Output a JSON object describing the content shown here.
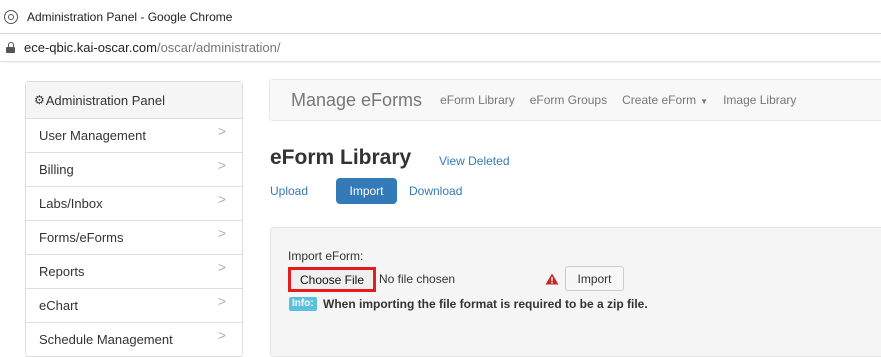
{
  "browser": {
    "window_title": "Administration Panel - Google Chrome",
    "url_host": "ece-qbic.kai-oscar.com",
    "url_path": "/oscar/administration/"
  },
  "sidebar": {
    "header": "Administration Panel",
    "items": [
      {
        "label": "User Management"
      },
      {
        "label": "Billing"
      },
      {
        "label": "Labs/Inbox"
      },
      {
        "label": "Forms/eForms"
      },
      {
        "label": "Reports"
      },
      {
        "label": "eChart"
      },
      {
        "label": "Schedule Management"
      }
    ]
  },
  "topnav": {
    "brand": "Manage eForms",
    "links": [
      "eForm Library",
      "eForm Groups",
      "Create eForm",
      "Image Library"
    ]
  },
  "page": {
    "title": "eForm Library",
    "view_deleted": "View Deleted",
    "tabs": [
      "Upload",
      "Import",
      "Download"
    ],
    "active_tab": "Import"
  },
  "import_form": {
    "label": "Import eForm:",
    "choose_file": "Choose File",
    "no_file": "No file chosen",
    "import_button": "Import",
    "info_badge": "Info:",
    "info_text": "When importing the file format is required to be a zip file."
  },
  "colors": {
    "link": "#337ab7",
    "highlight_border": "#e41c1c",
    "info_badge": "#5bc0de",
    "warning": "#c62828"
  },
  "icons": {
    "title_icon": "chrome-icon",
    "address_icon": "lock-icon",
    "sidebar_header_icon": "gear-icon",
    "sidebar_item_icon": "chevron-right-icon",
    "import_warning_icon": "warning-icon"
  }
}
